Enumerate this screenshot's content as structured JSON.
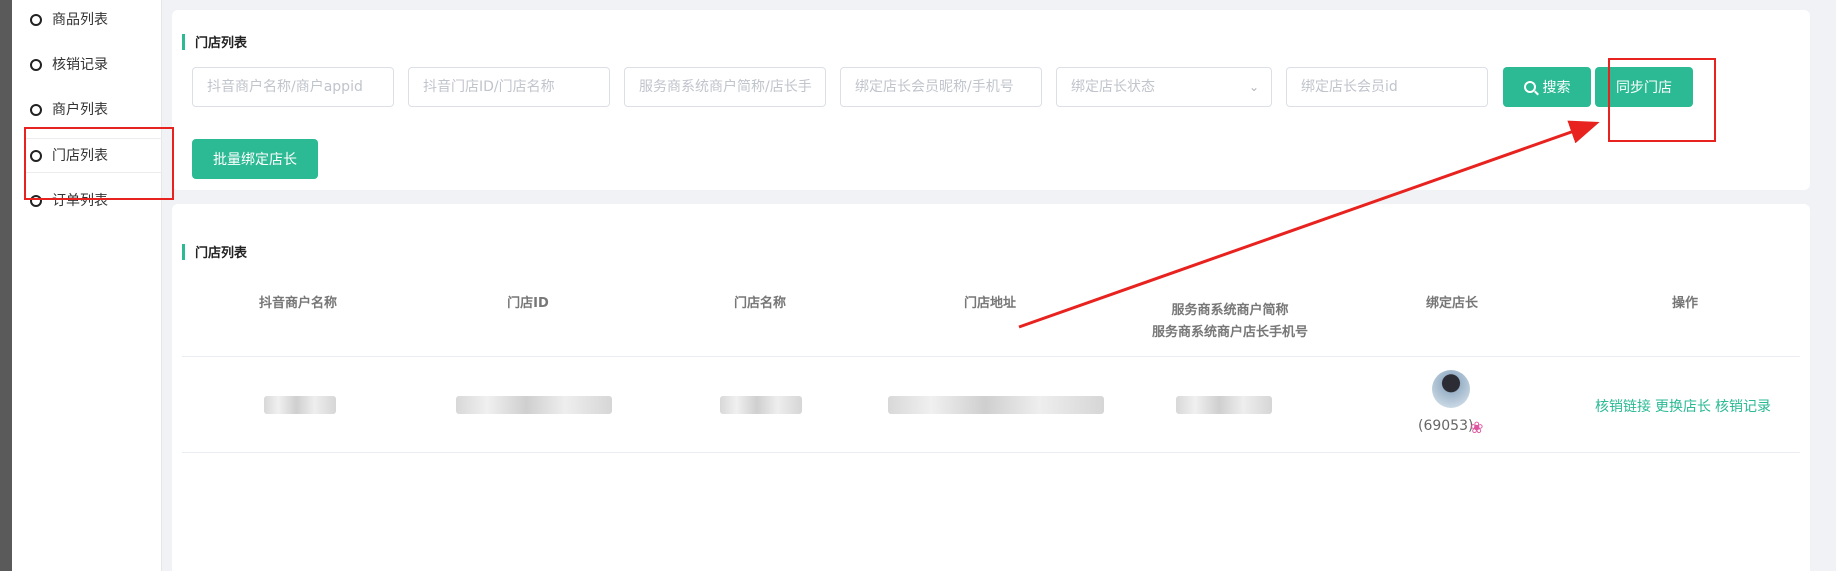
{
  "sidebar": {
    "items": [
      {
        "label": "商品列表"
      },
      {
        "label": "核销记录"
      },
      {
        "label": "商户列表"
      },
      {
        "label": "门店列表"
      },
      {
        "label": "订单列表"
      }
    ]
  },
  "filters": {
    "title": "门店列表",
    "fields": [
      {
        "placeholder": "抖音商户名称/商户appid"
      },
      {
        "placeholder": "抖音门店ID/门店名称"
      },
      {
        "placeholder": "服务商系统商户简称/店长手"
      },
      {
        "placeholder": "绑定店长会员昵称/手机号"
      },
      {
        "placeholder": "绑定店长状态"
      },
      {
        "placeholder": "绑定店长会员id"
      }
    ],
    "search_label": "搜索",
    "sync_label": "同步门店",
    "batch_label": "批量绑定店长"
  },
  "table": {
    "title": "门店列表",
    "headers": {
      "merchant_name": "抖音商户名称",
      "store_id": "门店ID",
      "store_name": "门店名称",
      "store_address": "门店地址",
      "sys_short_line1": "服务商系统商户简称",
      "sys_short_line2": "服务商系统商户店长手机号",
      "bound_manager": "绑定店长",
      "actions": "操作"
    },
    "rows": [
      {
        "manager_id": "(69053)",
        "actions": [
          "核销链接",
          "更换店长",
          "核销记录"
        ]
      }
    ]
  },
  "colors": {
    "accent": "#2bba94",
    "highlight": "#e8231f"
  },
  "icons": {
    "search": "search-icon",
    "select": "chevron-down-icon",
    "badge": "flower-icon"
  }
}
